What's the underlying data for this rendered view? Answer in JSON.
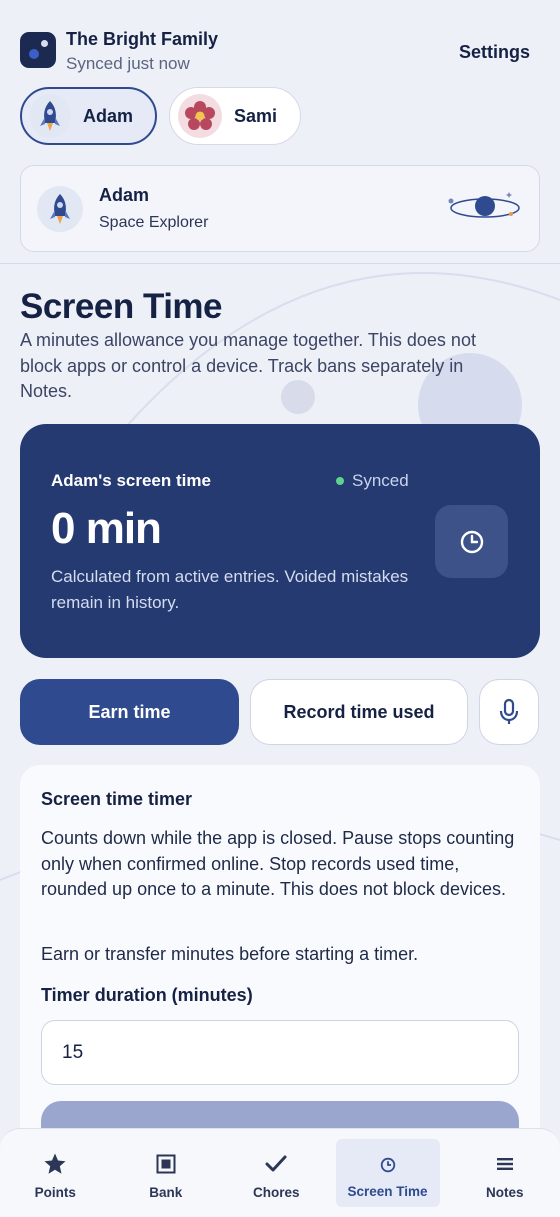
{
  "header": {
    "family_name": "The Bright Family",
    "sync_status": "Synced just now",
    "settings_label": "Settings"
  },
  "profiles": [
    {
      "name": "Adam",
      "avatar": "rocket-icon",
      "active": true
    },
    {
      "name": "Sami",
      "avatar": "flower-icon",
      "active": false
    }
  ],
  "profile_card": {
    "name": "Adam",
    "role": "Space Explorer",
    "badge": "planet-icon"
  },
  "page": {
    "title": "Screen Time",
    "description": "A minutes allowance you manage together. This does not block apps or control a device. Track bans separately in Notes."
  },
  "balance": {
    "label": "Adam's screen time",
    "sync": "Synced",
    "value": "0 min",
    "note": "Calculated from active entries. Voided mistakes remain in history."
  },
  "actions": {
    "earn_label": "Earn time",
    "record_label": "Record time used"
  },
  "timer": {
    "title": "Screen time timer",
    "description": "Counts down while the app is closed. Pause stops counting only when confirmed online. Stop records used time, rounded up once to a minute. This does not block devices.",
    "hint": "Earn or transfer minutes before starting a timer.",
    "duration_label": "Timer duration (minutes)",
    "duration_value": "15"
  },
  "nav": [
    {
      "label": "Points",
      "icon": "star-icon"
    },
    {
      "label": "Bank",
      "icon": "bank-icon"
    },
    {
      "label": "Chores",
      "icon": "check-icon"
    },
    {
      "label": "Screen Time",
      "icon": "clock-icon",
      "active": true
    },
    {
      "label": "Notes",
      "icon": "notes-icon"
    }
  ],
  "colors": {
    "primary": "#2f4a8f",
    "card_dark": "#243a70",
    "sync_dot": "#5fd38e",
    "background": "#eef0f8"
  }
}
